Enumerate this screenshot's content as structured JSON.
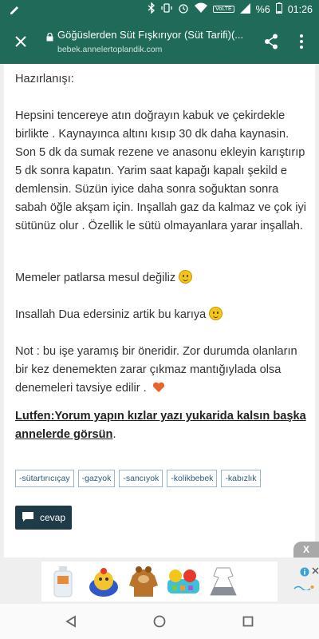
{
  "status_bar": {
    "battery_pct": "%6",
    "network_badge": "VoLTE",
    "time": "01:26",
    "icons": [
      "edit-icon",
      "bluetooth-icon",
      "vibrate-icon",
      "alarm-icon",
      "wifi-icon",
      "signal-icon",
      "battery-icon"
    ]
  },
  "toolbar": {
    "title": "Göğüslerden Süt Fışkırıyor (Süt Tarifi)(...",
    "url": "bebek.annelertoplandik.com",
    "icons": [
      "close-icon",
      "lock-icon",
      "share-icon",
      "more-vert-icon"
    ]
  },
  "post": {
    "heading": "Hazırlanışı:",
    "recipe": "Hepsini tencereye atın doğrayın kabuk ve çekirdekle birlikte . Kaynayınca altını kısıp 30 dk daha kaynasin. Son 5 dk da sumak rezene ve anasonu ekleyin karıştırıp 5 dk sonra kapatın.  Yarim saat kapağı kapalı şekild e demlensin.  Süzün iyice daha sonra soğuktan sonra sabah öğle akşam için.  Inşallah gaz da kalmaz ve çok iyi sütünüz olur . Özellik le sütü olmayanlara yarar inşallah.",
    "memeler": "Memeler patlarsa mesul değiliz",
    "insallah": "Insallah Dua edersiniz artik bu karıya",
    "not": "Not : bu işe yaramış bir öneridir.  Zor durumda olanların bir kez denemekten zarar çıkmaz mantığıylada olsa denemeleri tavsiye edilir .",
    "lutfen": "Lutfen:Yorum yapın kızlar yazı yukarida kalsın başka annelerde görsün",
    "lutfen_end": "."
  },
  "tags": [
    "-sütartırıcıçay",
    "-gazyok",
    "-sancıyok",
    "-kolikbebek",
    "-kabızlık"
  ],
  "reply": {
    "label": "cevap"
  },
  "ad": {
    "close": "X",
    "images": [
      "baby-bottle",
      "baby-toy",
      "baby-hoodie",
      "baby-rattle",
      "baby-dress"
    ],
    "colors": {
      "accent": "#3aa0d6"
    }
  },
  "nav": {
    "icons": [
      "back-icon",
      "home-icon",
      "recents-icon"
    ]
  },
  "colors": {
    "brand": "#1f6a58",
    "text": "#333333",
    "tag_border": "#9bb6c9",
    "button": "#1f3b47"
  }
}
